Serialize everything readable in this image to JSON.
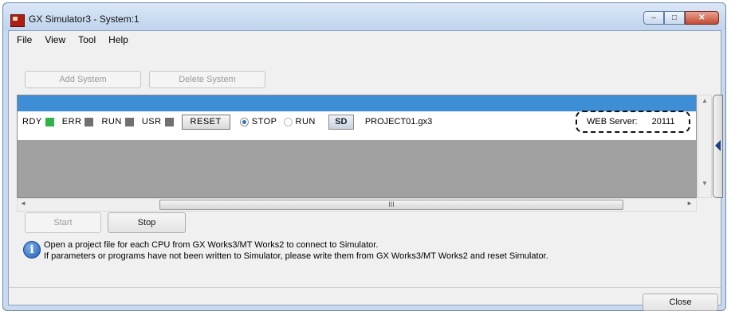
{
  "window": {
    "title": "GX Simulator3 - System:1",
    "caption_buttons": {
      "minimize": "–",
      "maximize": "□",
      "close": "✕"
    }
  },
  "menu": [
    "File",
    "View",
    "Tool",
    "Help"
  ],
  "toolbar": {
    "add_system": "Add System",
    "delete_system": "Delete System"
  },
  "cpu": {
    "leds": [
      {
        "label": "RDY",
        "color": "#2fb34a"
      },
      {
        "label": "ERR",
        "color": "#707070"
      },
      {
        "label": "RUN",
        "color": "#707070"
      },
      {
        "label": "USR",
        "color": "#707070"
      }
    ],
    "reset_label": "RESET",
    "stop_label": "STOP",
    "run_label": "RUN",
    "mode_selected": "STOP",
    "sd_label": "SD",
    "project": "PROJECT01.gx3",
    "web_server_label": "WEB Server:",
    "web_server_port": "20111"
  },
  "scrollbar": {
    "grip": "III",
    "up": "▲",
    "down": "▼",
    "left": "◄",
    "right": "►"
  },
  "actions": {
    "start": "Start",
    "stop": "Stop"
  },
  "info": {
    "icon": "i",
    "line1": "Open a project file for each CPU from GX Works3/MT Works2 to connect to Simulator.",
    "line2": "If parameters or programs have not been written to Simulator, please write them from GX Works3/MT Works2 and reset Simulator."
  },
  "footer": {
    "close": "Close"
  },
  "colors": {
    "selected_row": "#3e8ed6",
    "rdy_led": "#2fb34a",
    "inactive_led": "#707070"
  }
}
